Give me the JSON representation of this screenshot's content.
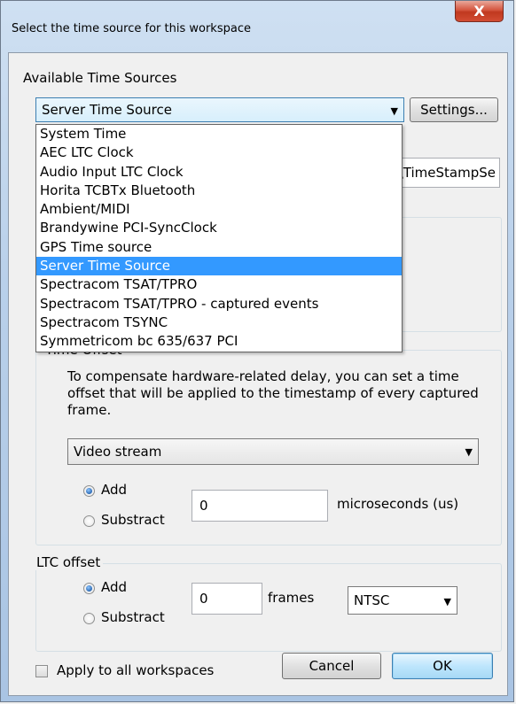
{
  "window": {
    "title": "Select the time source for this workspace",
    "close_glyph": "X"
  },
  "time_sources": {
    "label": "Available Time Sources",
    "selected": "Server Time Source",
    "settings_label": "Settings...",
    "path_fragment": "\\TimeStampSe",
    "options": [
      "System Time",
      "AEC LTC Clock",
      "Audio Input LTC Clock",
      "Horita TCBTx Bluetooth",
      "Ambient/MIDI",
      "Brandywine PCI-SyncClock",
      "GPS Time source",
      "Server Time Source",
      "Spectracom TSAT/TPRO",
      "Spectracom TSAT/TPRO - captured events",
      "Spectracom TSYNC",
      "Symmetricom bc 635/637 PCI"
    ],
    "selected_index": 7
  },
  "time_offset": {
    "title": "Time Offset",
    "description": "To compensate hardware-related delay, you can set a time offset that will be applied to the timestamp of every captured frame.",
    "stream_selected": "Video stream",
    "add_label": "Add",
    "subtract_label": "Substract",
    "value": "0",
    "unit": "microseconds (us)"
  },
  "ltc_offset": {
    "title": "LTC offset",
    "add_label": "Add",
    "subtract_label": "Substract",
    "value": "0",
    "unit": "frames",
    "format_selected": "NTSC"
  },
  "footer": {
    "apply_all_label": "Apply to all workspaces",
    "cancel_label": "Cancel",
    "ok_label": "OK"
  },
  "colors": {
    "selection": "#3399ff",
    "close_button": "#c0381f",
    "default_button_border": "#3c7fb1"
  }
}
